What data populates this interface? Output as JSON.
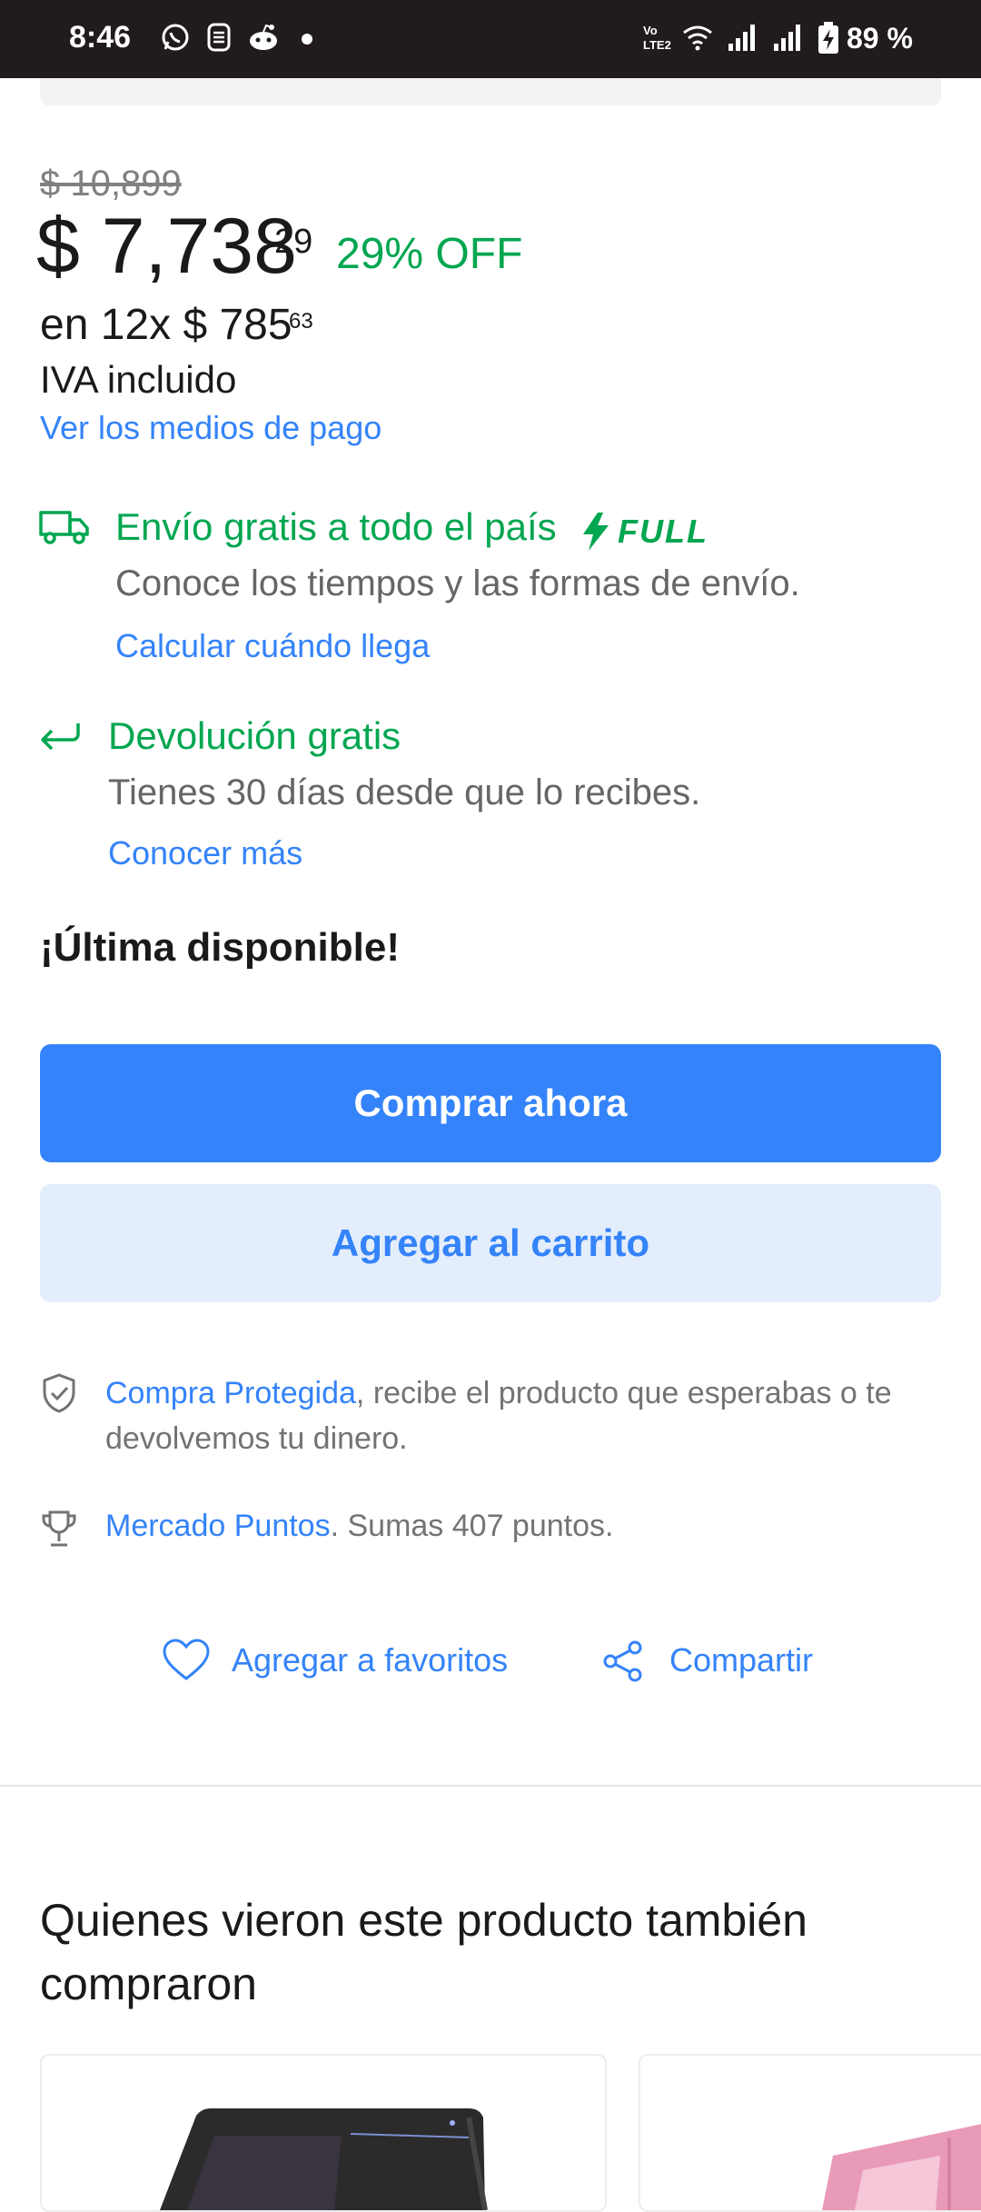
{
  "status_bar": {
    "time": "8:46",
    "battery": "89 %",
    "icons": [
      "whatsapp-icon",
      "notification-icon",
      "reddit-icon",
      "dot-icon",
      "volte-icon",
      "wifi-icon",
      "signal-icon",
      "signal-icon",
      "battery-charging-icon"
    ]
  },
  "pricing": {
    "original_price": "$ 10,899",
    "price": "$ 7,738",
    "price_cents": "29",
    "discount": "29% OFF",
    "installments": "en 12x $ 785",
    "installment_cents": "63",
    "tax_note": "IVA incluido",
    "payment_link": "Ver los medios de pago"
  },
  "shipping": {
    "icon": "truck-icon",
    "title": "Envío gratis a todo el país",
    "badge": "FULL",
    "badge_icon": "lightning-icon",
    "subtitle": "Conoce los tiempos y las formas de envío.",
    "link": "Calcular cuándo llega"
  },
  "returns": {
    "icon": "return-arrow-icon",
    "title": "Devolución gratis",
    "subtitle": "Tienes 30 días desde que lo recibes.",
    "link": "Conocer más"
  },
  "stock_label": "¡Última disponible!",
  "actions": {
    "buy_now": "Comprar ahora",
    "add_to_cart": "Agregar al carrito"
  },
  "benefits": {
    "protected_link": "Compra Protegida",
    "protected_text": ", recibe el producto que esperabas o te devolvemos tu dinero.",
    "points_link": "Mercado Puntos",
    "points_text": ". Sumas 407 puntos."
  },
  "social": {
    "favorite": "Agregar a favoritos",
    "share": "Compartir"
  },
  "recommendations": {
    "title": "Quienes vieron este producto también compraron"
  },
  "colors": {
    "accent_blue": "#3483fa",
    "green": "#00a650",
    "secondary_button_bg": "#e3edfb"
  }
}
